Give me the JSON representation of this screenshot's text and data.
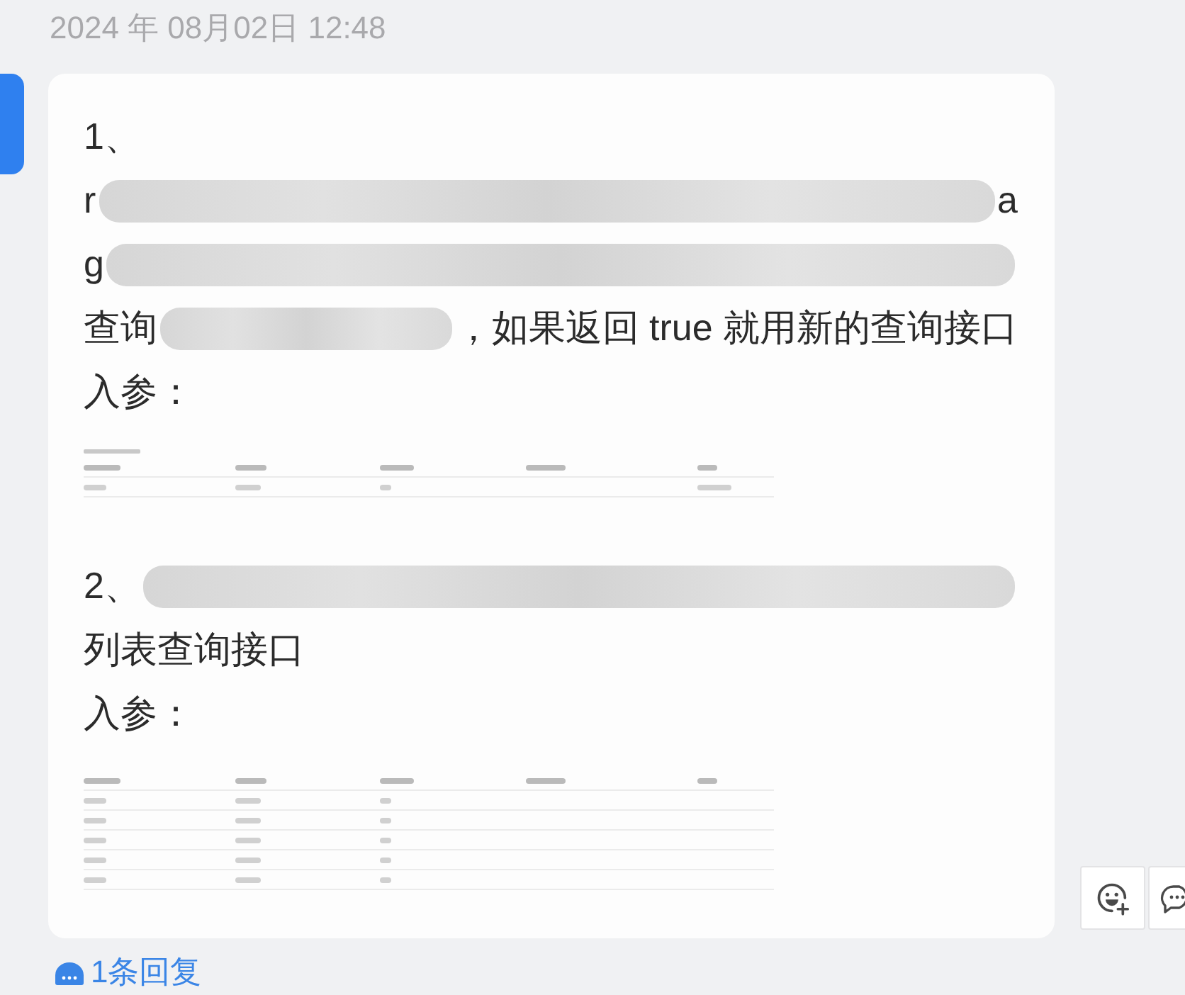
{
  "timestamp": "2024 年 08月02日 12:48",
  "message": {
    "highlighted": true,
    "blocks": [
      {
        "kind": "line",
        "segments": [
          {
            "kind": "text",
            "text": "1、"
          }
        ]
      },
      {
        "kind": "line",
        "segments": [
          {
            "kind": "text",
            "text": "r"
          },
          {
            "kind": "redacted"
          },
          {
            "kind": "text",
            "text": "a"
          }
        ]
      },
      {
        "kind": "line",
        "segments": [
          {
            "kind": "text",
            "text": "g"
          },
          {
            "kind": "redacted"
          }
        ]
      },
      {
        "kind": "line",
        "segments": [
          {
            "kind": "text",
            "text": "查询"
          },
          {
            "kind": "redacted"
          },
          {
            "kind": "text",
            "text": "，如果返回 true 就用新的查询接口"
          }
        ]
      },
      {
        "kind": "line",
        "segments": [
          {
            "kind": "text",
            "text": "入参："
          }
        ]
      },
      {
        "kind": "table_image",
        "caption_shown": true,
        "rows": [
          {
            "kind": "header",
            "cells": [
              {
                "kind": "blurred"
              },
              {
                "kind": "blurred"
              },
              {
                "kind": "blurred"
              },
              {
                "kind": "blurred"
              },
              {
                "kind": "blurred"
              }
            ]
          },
          {
            "kind": "row",
            "cells": [
              {
                "kind": "blurred"
              },
              {
                "kind": "blurred"
              },
              {
                "kind": "blurred"
              },
              {
                "kind": "empty"
              },
              {
                "kind": "blurred"
              }
            ]
          }
        ]
      },
      {
        "kind": "line",
        "segments": [
          {
            "kind": "text",
            "text": "2、"
          },
          {
            "kind": "redacted"
          }
        ]
      },
      {
        "kind": "line",
        "segments": [
          {
            "kind": "text",
            "text": "列表查询接口"
          }
        ]
      },
      {
        "kind": "line",
        "segments": [
          {
            "kind": "text",
            "text": "入参："
          }
        ]
      },
      {
        "kind": "table_image",
        "rows": [
          {
            "kind": "header",
            "cells": [
              {
                "kind": "blurred"
              },
              {
                "kind": "blurred"
              },
              {
                "kind": "blurred"
              },
              {
                "kind": "blurred"
              },
              {
                "kind": "blurred"
              }
            ]
          },
          {
            "kind": "row",
            "cells": [
              {
                "kind": "blurred"
              },
              {
                "kind": "blurred"
              },
              {
                "kind": "blurred"
              },
              {
                "kind": "empty"
              },
              {
                "kind": "empty"
              }
            ]
          },
          {
            "kind": "row",
            "cells": [
              {
                "kind": "blurred"
              },
              {
                "kind": "blurred"
              },
              {
                "kind": "blurred"
              },
              {
                "kind": "empty"
              },
              {
                "kind": "empty"
              }
            ]
          },
          {
            "kind": "row",
            "cells": [
              {
                "kind": "blurred"
              },
              {
                "kind": "blurred"
              },
              {
                "kind": "blurred"
              },
              {
                "kind": "empty"
              },
              {
                "kind": "empty"
              }
            ]
          },
          {
            "kind": "row",
            "cells": [
              {
                "kind": "blurred"
              },
              {
                "kind": "blurred"
              },
              {
                "kind": "blurred"
              },
              {
                "kind": "empty"
              },
              {
                "kind": "empty"
              }
            ]
          },
          {
            "kind": "row",
            "cells": [
              {
                "kind": "blurred"
              },
              {
                "kind": "blurred"
              },
              {
                "kind": "blurred"
              },
              {
                "kind": "empty"
              },
              {
                "kind": "empty"
              }
            ]
          }
        ]
      }
    ]
  },
  "reply_link": {
    "text": "1条回复"
  },
  "actions": [
    {
      "kind": "add_reaction"
    },
    {
      "kind": "comment"
    }
  ]
}
